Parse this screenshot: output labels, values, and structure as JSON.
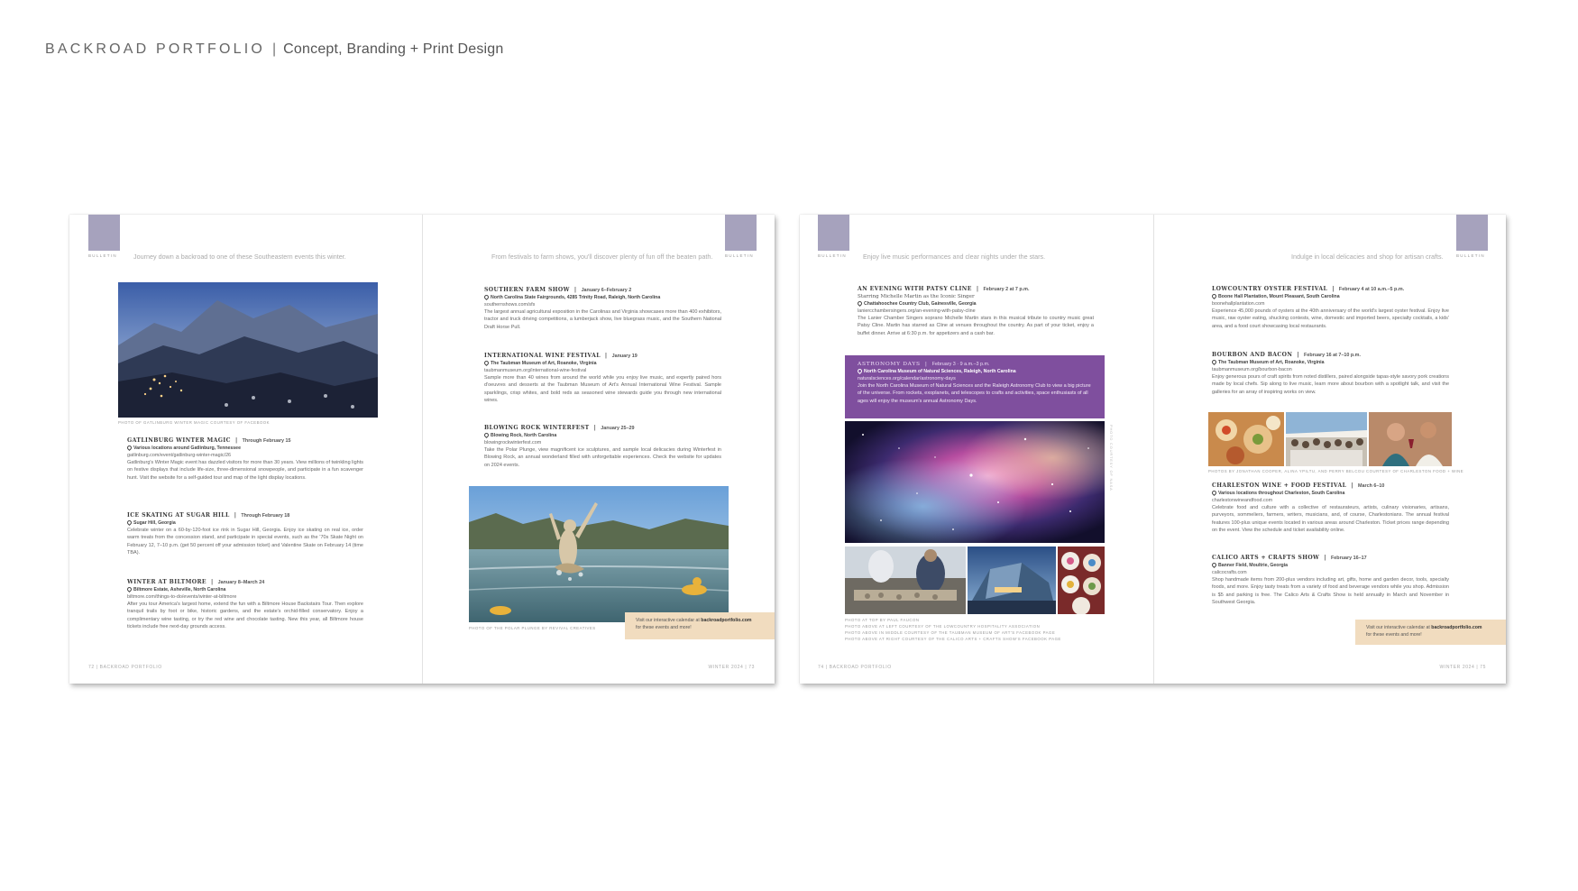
{
  "header": {
    "brand": "BACKROAD PORTFOLIO",
    "separator": "|",
    "subtitle": "Concept, Branding + Print Design"
  },
  "spread1": {
    "left": {
      "section": "BULLETIN",
      "tagline": "Journey down a backroad to one of these Southeastern events this winter.",
      "photo_caption": "PHOTO OF GATLINBURG WINTER MAGIC COURTESY OF FACEBOOK",
      "events": [
        {
          "title": "GATLINBURG WINTER MAGIC",
          "date": "Through February 15",
          "location": "Various locations around Gatlinburg, Tennessee",
          "url": "gatlinburg.com/event/gatlinburg-winter-magic/26",
          "body": "Gatlinburg's Winter Magic event has dazzled visitors for more than 30 years. View millions of twinkling lights on festive displays that include life-size, three-dimensional snowpeople, and participate in a fun scavenger hunt. Visit the website for a self-guided tour and map of the light display locations."
        },
        {
          "title": "ICE SKATING AT SUGAR HILL",
          "date": "Through February 18",
          "location": "Sugar Hill, Georgia",
          "url": "",
          "body": "Celebrate winter on a 60-by-120-foot ice rink in Sugar Hill, Georgia. Enjoy ice skating on real ice, order warm treats from the concession stand, and participate in special events, such as the '70s Skate Night on February 12, 7–10 p.m. (get 50 percent off your admission ticket) and Valentine Skate on February 14 (time TBA)."
        },
        {
          "title": "WINTER AT BILTMORE",
          "date": "January 8–March 24",
          "location": "Biltmore Estate, Asheville, North Carolina",
          "url": "biltmore.com/things-to-do/events/winter-at-biltmore",
          "body": "After you tour America's largest home, extend the fun with a Biltmore House Backstairs Tour. Then explore tranquil trails by foot or bike, historic gardens, and the estate's orchid-filled conservatory. Enjoy a complimentary wine tasting, or try the red wine and chocolate tasting. New this year, all Biltmore house tickets include free next-day grounds access."
        }
      ],
      "folio": "72 | BACKROAD PORTFOLIO"
    },
    "right": {
      "section": "BULLETIN",
      "tagline": "From festivals to farm shows, you'll discover plenty of fun off the beaten path.",
      "events": [
        {
          "title": "SOUTHERN FARM SHOW",
          "date": "January 6–February 2",
          "location": "North Carolina State Fairgrounds, 4285 Trinity Road, Raleigh, North Carolina",
          "url": "southernshows.com/sfs",
          "body": "The largest annual agricultural exposition in the Carolinas and Virginia showcases more than 400 exhibitors, tractor and truck driving competitions, a lumberjack show, live bluegrass music, and the Southern National Draft Horse Pull."
        },
        {
          "title": "INTERNATIONAL WINE FESTIVAL",
          "date": "January 19",
          "location": "The Taubman Museum of Art, Roanoke, Virginia",
          "url": "taubmanmuseum.org/international-wine-festival",
          "body": "Sample more than 40 wines from around the world while you enjoy live music, and expertly paired hors d'oeuvres and desserts at the Taubman Museum of Art's Annual International Wine Festival. Sample sparklings, crisp whites, and bold reds as seasoned wine stewards guide you through new international wines."
        },
        {
          "title": "BLOWING ROCK WINTERFEST",
          "date": "January 25–29",
          "location": "Blowing Rock, North Carolina",
          "url": "blowingrockwinterfest.com",
          "body": "Take the Polar Plunge, view magnificent ice sculptures, and sample local delicacies during Winterfest in Blowing Rock, an annual wonderland filled with unforgettable experiences. Check the website for updates on 2024 events."
        }
      ],
      "photo_caption": "PHOTO OF THE POLAR PLUNGE BY REVIVAL CREATIVES",
      "callout_text": "Visit our interactive calendar at",
      "callout_url": "backroadportfolio.com",
      "callout_tail": "for these events and more!",
      "folio": "WINTER 2024 | 73"
    }
  },
  "spread2": {
    "left": {
      "section": "BULLETIN",
      "tagline": "Enjoy live music performances and clear nights under the stars.",
      "events": [
        {
          "title": "AN EVENING WITH PATSY CLINE",
          "date": "February 2 at 7 p.m.",
          "subtitle": "Starring Michelle Martin as the Iconic Singer",
          "location": "Chattahoochee Country Club, Gainesville, Georgia",
          "url": "laniercchambersingers.org/an-evening-with-patsy-cline",
          "body": "The Lanier Chamber Singers soprano Michelle Martin stars in this musical tribute to country music great Patsy Cline. Martin has starred as Cline at venues throughout the country. As part of your ticket, enjoy a buffet dinner. Arrive at 6:30 p.m. for appetizers and a cash bar."
        }
      ],
      "astro": {
        "title": "ASTRONOMY DAYS",
        "date": "February 3 · 9 a.m.–3 p.m.",
        "location": "North Carolina Museum of Natural Sciences, Raleigh, North Carolina",
        "url": "naturalsciences.org/calendar/astronomy-days",
        "body": "Join the North Carolina Museum of Natural Sciences and the Raleigh Astronomy Club to view a big picture of the universe. From rockets, exoplanets, and telescopes to crafts and activities, space enthusiasts of all ages will enjoy the museum's annual Astronomy Days."
      },
      "photo_side_caption": "PHOTO COURTESY OF NASA",
      "photo_captions": [
        "PHOTO AT TOP BY PAUL FAUCON",
        "PHOTO ABOVE AT LEFT COURTESY OF THE LOWCOUNTRY HOSPITALITY ASSOCIATION",
        "PHOTO ABOVE IN MIDDLE COURTESY OF THE TAUBMAN MUSEUM OF ART'S FACEBOOK PAGE",
        "PHOTO ABOVE AT RIGHT COURTESY OF THE CALICO ARTS + CRAFTS SHOW'S FACEBOOK PAGE"
      ],
      "folio": "74 | BACKROAD PORTFOLIO"
    },
    "right": {
      "section": "BULLETIN",
      "tagline": "Indulge in local delicacies and shop for artisan crafts.",
      "events": [
        {
          "title": "LOWCOUNTRY OYSTER FESTIVAL",
          "date": "February 4 at 10 a.m.–5 p.m.",
          "location": "Boone Hall Plantation, Mount Pleasant, South Carolina",
          "url": "boonehallplantation.com",
          "body": "Experience 45,000 pounds of oysters at the 40th anniversary of the world's largest oyster festival. Enjoy live music, raw oyster eating, shucking contests, wine, domestic and imported beers, specialty cocktails, a kids' area, and a food court showcasing local restaurants."
        },
        {
          "title": "BOURBON AND BACON",
          "date": "February 16 at 7–10 p.m.",
          "location": "The Taubman Museum of Art, Roanoke, Virginia",
          "url": "taubmanmuseum.org/bourbon-bacon",
          "body": "Enjoy generous pours of craft spirits from noted distillers, paired alongside tapas-style savory pork creations made by local chefs. Sip along to live music, learn more about bourbon with a spotlight talk, and visit the galleries for an array of inspiring works on view."
        },
        {
          "title": "CHARLESTON WINE + FOOD FESTIVAL",
          "date": "March 6–10",
          "location": "Various locations throughout Charleston, South Carolina",
          "url": "charlestonwineandfood.com",
          "body": "Celebrate food and culture with a collective of restaurateurs, artists, culinary visionaries, artisans, purveyors, sommeliers, farmers, writers, musicians, and, of course, Charlestonians. The annual festival features 100-plus unique events located in various areas around Charleston. Ticket prices range depending on the event. View the schedule and ticket availability online."
        },
        {
          "title": "CALICO ARTS + CRAFTS SHOW",
          "date": "February 16–17",
          "location": "Banner Field, Moultrie, Georgia",
          "url": "calicocrafts.com",
          "body": "Shop handmade items from 200-plus vendors including art, gifts, home and garden decor, tools, specialty foods, and more. Enjoy tasty treats from a variety of food and beverage vendors while you shop. Admission is $5 and parking is free. The Calico Arts & Crafts Show is held annually in March and November in Southwest Georgia."
        }
      ],
      "photo_caption": "PHOTOS BY JONATHAN COOPER, ALINA YPILTU, AND PERRY BELCOU COURTESY OF CHARLESTON FOOD + WINE",
      "callout_text": "Visit our interactive calendar at",
      "callout_url": "backroadportfolio.com",
      "callout_tail": "for these events and more!",
      "folio": "WINTER 2024 | 75"
    }
  },
  "colors": {
    "tab": "#a6a2bd",
    "astro_panel": "#7f4f9e",
    "callout": "#f1dcbf"
  }
}
